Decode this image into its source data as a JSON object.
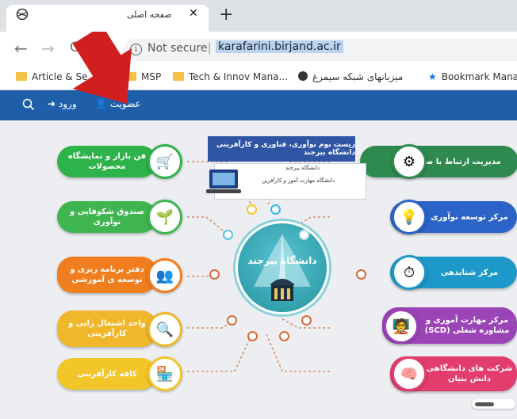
{
  "browser": {
    "tab_title": "صفحه اصلی",
    "tab_close": "✕",
    "new_tab": "+",
    "not_secure": "Not secure",
    "separator": "|",
    "url": "karafarini.birjand.ac.ir",
    "back": "←",
    "forward": "→",
    "reload": "C",
    "info": "i"
  },
  "bookmarks": [
    {
      "label": "Article & Se",
      "icon": "folder-icon"
    },
    {
      "label": "MSP",
      "icon": "folder-icon"
    },
    {
      "label": "Tech & Innov Mana...",
      "icon": "folder-icon"
    },
    {
      "label": "میزبانهای شبکه سیمرغ",
      "icon": "globe-icon"
    },
    {
      "label": "Bookmark Manag",
      "icon": "star-icon"
    }
  ],
  "site_nav": {
    "membership": "عضویت",
    "login": "ورود",
    "search_icon": "search-icon"
  },
  "banner": {
    "title": "زیست بوم نوآوری، فناوری و کارآفرینی دانشگاه بیرجند",
    "line1": "دانشگاه بیرجند",
    "line2": "دانشگاه مهارت آموز و کارآفرین"
  },
  "center": {
    "name": "دانشگاه بیرجند"
  },
  "left_items": [
    {
      "label": "فن بازار و نمایشگاه محصولات",
      "color": "#2db34a"
    },
    {
      "label": "صندوق شکوفایی و نوآوری",
      "color": "#3fb550"
    },
    {
      "label": "دفتر برنامه ریزی و توسعه ی آموزشی",
      "color": "#f07d1e"
    },
    {
      "label": "واحد اشتغال زایی و کارآفرینی",
      "color": "#f1b72a"
    },
    {
      "label": "کافه کارآفرینی",
      "color": "#f2c629"
    }
  ],
  "right_items": [
    {
      "label": "مدیریت ارتباط با صنعت",
      "color": "#2f8a50"
    },
    {
      "label": "مرکز توسعه نوآوری",
      "color": "#2c63c8"
    },
    {
      "label": "مرکز شتابدهی",
      "color": "#1d98c8"
    },
    {
      "label": "مرکز مهارت آموزی و مشاوره شغلی (SCD)",
      "color": "#9b44b7"
    },
    {
      "label": "شرکت های دانشگاهی دانش بنیان",
      "color": "#e33d6e"
    }
  ]
}
